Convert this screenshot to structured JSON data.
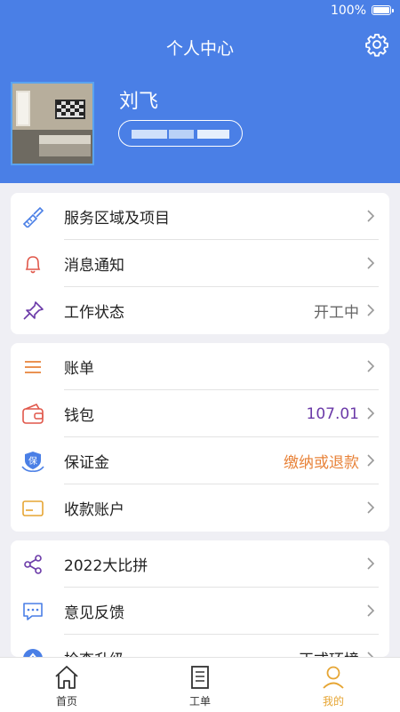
{
  "status_bar": {
    "battery": "100%"
  },
  "header": {
    "title": "个人中心",
    "user_name": "刘飞"
  },
  "colors": {
    "primary": "#4a7fe6",
    "orange": "#e8833a",
    "purple": "#6b3aa8",
    "active_tab": "#e6a533"
  },
  "sections": [
    {
      "items": [
        {
          "icon": "broom-icon",
          "label": "服务区域及项目",
          "value": ""
        },
        {
          "icon": "bell-icon",
          "label": "消息通知",
          "value": ""
        },
        {
          "icon": "pin-icon",
          "label": "工作状态",
          "value": "开工中"
        }
      ]
    },
    {
      "items": [
        {
          "icon": "menu-icon",
          "label": "账单",
          "value": ""
        },
        {
          "icon": "wallet-icon",
          "label": "钱包",
          "value": "107.01"
        },
        {
          "icon": "deposit-icon",
          "label": "保证金",
          "value": "缴纳或退款"
        },
        {
          "icon": "card-icon",
          "label": "收款账户",
          "value": ""
        }
      ]
    },
    {
      "items": [
        {
          "icon": "share-icon",
          "label": "2022大比拼",
          "value": ""
        },
        {
          "icon": "feedback-icon",
          "label": "意见反馈",
          "value": ""
        },
        {
          "icon": "upgrade-icon",
          "label": "检查升级",
          "value": "正式环境"
        }
      ]
    }
  ],
  "deposit_icon_text": "保",
  "tabbar": [
    {
      "icon": "home-icon",
      "label": "首页",
      "active": false
    },
    {
      "icon": "order-icon",
      "label": "工单",
      "active": false
    },
    {
      "icon": "profile-icon",
      "label": "我的",
      "active": true
    }
  ]
}
